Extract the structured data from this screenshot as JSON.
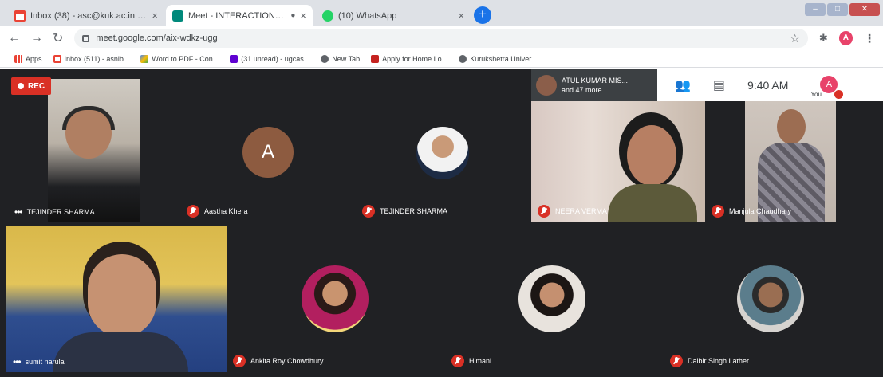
{
  "browser": {
    "tabs": [
      {
        "title": "Inbox (38) - asc@kuk.ac.in - Kuru"
      },
      {
        "title": "Meet - INTERACTION PROG"
      },
      {
        "title": "(10) WhatsApp"
      }
    ],
    "address": "meet.google.com/aix-wdkz-ugg",
    "bookmarks": [
      {
        "label": "Apps"
      },
      {
        "label": "Inbox (511) - asnib..."
      },
      {
        "label": "Word to PDF - Con..."
      },
      {
        "label": "(31 unread) - ugcas..."
      },
      {
        "label": "New Tab"
      },
      {
        "label": "Apply for Home Lo..."
      },
      {
        "label": "Kurukshetra Univer..."
      }
    ],
    "profile_initial": "A"
  },
  "meet": {
    "rec_label": "REC",
    "presenter": {
      "name": "ATUL KUMAR MIS...",
      "more": "and 47 more"
    },
    "time": "9:40 AM",
    "you_initial": "A",
    "you_label": "You",
    "participants": [
      {
        "name": "TEJINDER SHARMA"
      },
      {
        "name": "Aastha Khera",
        "initial": "A"
      },
      {
        "name": "TEJINDER SHARMA"
      },
      {
        "name": "NEERA VERMA"
      },
      {
        "name": "Manjula Chaudhary"
      },
      {
        "name": "sumit narula"
      },
      {
        "name": "Ankita Roy Chowdhury"
      },
      {
        "name": "Himani"
      },
      {
        "name": "Dalbir Singh Lather"
      }
    ]
  }
}
